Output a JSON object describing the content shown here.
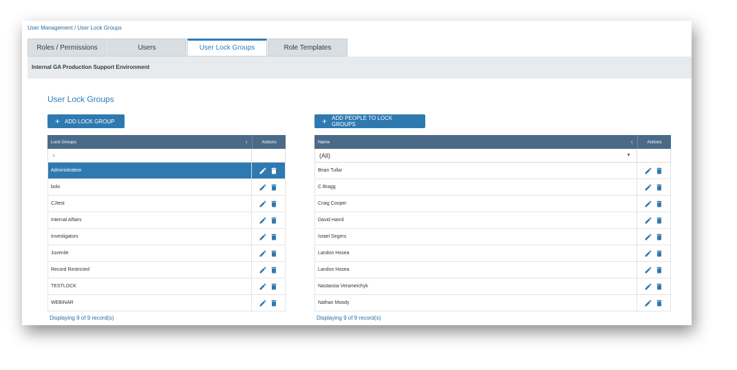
{
  "breadcrumb": "User Management / User Lock Groups",
  "tabs": [
    {
      "label": "Roles / Permissions",
      "active": false
    },
    {
      "label": "Users",
      "active": false
    },
    {
      "label": "User Lock Groups",
      "active": true
    },
    {
      "label": "Role Templates",
      "active": false
    }
  ],
  "environment": "Internal GA Production Support Environment",
  "section_title": "User Lock Groups",
  "left": {
    "button_label": "ADD LOCK GROUP",
    "col_header": "Lock Groups",
    "actions_header": "Actions",
    "rows": [
      "Administration",
      "bolo",
      "CJtest",
      "Internal Affairs",
      "Investigators",
      "Juvenile",
      "Record Restricted",
      "TESTLOCK",
      "WEBINAR"
    ],
    "selected_index": 0,
    "footer": "Displaying 9 of 9 record(s)"
  },
  "right": {
    "button_label": "ADD PEOPLE TO LOCK GROUPS",
    "col_header": "Name",
    "actions_header": "Actions",
    "filter_value": "(All)",
    "rows": [
      "Brian Tullar",
      "C Bragg",
      "Craig Cooper",
      "David Hamil",
      "Israel Segers",
      "Landon Hosea",
      "Landon Hosea",
      "Nastassia Verameichyk",
      "Nathan Moody"
    ],
    "footer": "Displaying 9 of 9 record(s)"
  },
  "colors": {
    "accent": "#2f79b1",
    "header": "#4a6a88",
    "icon": "#2f79b1"
  }
}
